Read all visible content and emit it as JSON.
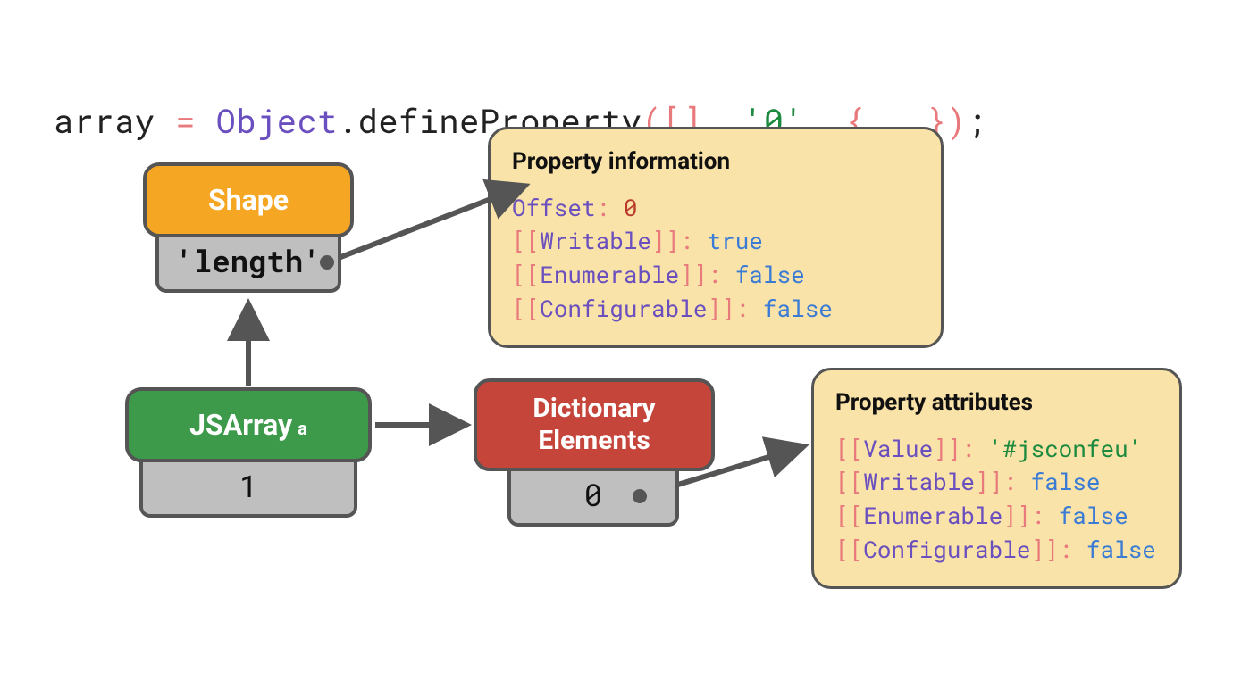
{
  "code": {
    "var": "array",
    "assign": " = ",
    "object": "Object",
    "dot": ".",
    "method": "defineProperty",
    "lparen": "(",
    "lbracket": "[",
    "rbracket": "]",
    "comma1": ", ",
    "str": "'0'",
    "comma2": ", ",
    "lbrace": "{ ",
    "ellipsis": "…",
    "rbrace": " }",
    "rparen": ")",
    "semi": ";"
  },
  "shape": {
    "label": "Shape",
    "prop": "'length'"
  },
  "jsarray": {
    "label": "JSArray",
    "sub": "a",
    "value": "1"
  },
  "dictionary": {
    "line1": "Dictionary",
    "line2": "Elements",
    "value": "0"
  },
  "panel1": {
    "title": "Property information",
    "offset_key": "Offset",
    "offset_val": "0",
    "writable_key": "Writable",
    "writable_val": "true",
    "enumerable_key": "Enumerable",
    "enumerable_val": "false",
    "configurable_key": "Configurable",
    "configurable_val": "false"
  },
  "panel2": {
    "title": "Property attributes",
    "value_key": "Value",
    "value_val": "'#jsconfeu'",
    "writable_key": "Writable",
    "writable_val": "false",
    "enumerable_key": "Enumerable",
    "enumerable_val": "false",
    "configurable_key": "Configurable",
    "configurable_val": "false"
  }
}
